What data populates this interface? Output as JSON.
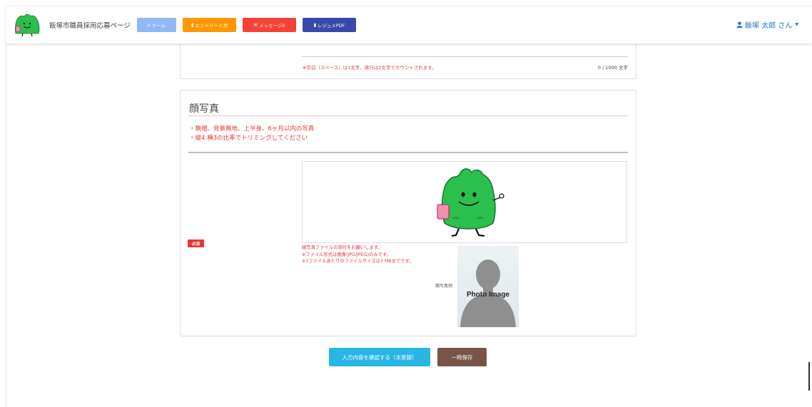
{
  "header": {
    "site_title": "飯塚市職員採用応募ページ",
    "nav": [
      {
        "label": "ホーム",
        "icon": "home-icon",
        "color": "#90b8f8"
      },
      {
        "label": "エントリー入力",
        "icon": "document-icon",
        "color": "#ff9800"
      },
      {
        "label": "メッセージ0",
        "icon": "envelope-icon",
        "color": "#f44336"
      },
      {
        "label": "レジュメPDF",
        "icon": "document-icon",
        "color": "#3949ab"
      }
    ],
    "user_name": "飯塚 太郎 さん",
    "user_icon": "user-icon"
  },
  "previous_section": {
    "space_note": "※空白（スペース）は1文字、改行は2文字でカウントされます。",
    "char_counter": "0 / 1000 文字"
  },
  "photo_section": {
    "title": "顔写真",
    "requirements": [
      "・無帽、背景無地、上半身、6ヶ月以内の写真",
      "・縦4:横3の比率でトリミングしてください"
    ],
    "required_badge": "必須",
    "file_notes": [
      "顔写真ファイルの添付をお願いします。",
      "※ファイル形式は画像(JPG/JPEG)のみです。",
      "※1ファイルあたりのファイルサイズは3 MBまでです。"
    ],
    "example_label": "顔写真例",
    "example_caption": "Photo Image"
  },
  "actions": {
    "confirm_label": "入力内容を確認する（本登録）",
    "save_label": "一時保存"
  },
  "colors": {
    "accent_red": "#e53935",
    "confirm_button": "#29b6e6",
    "save_button": "#795548",
    "user_link": "#1976d2",
    "mascot_green": "#2bbf4e"
  }
}
